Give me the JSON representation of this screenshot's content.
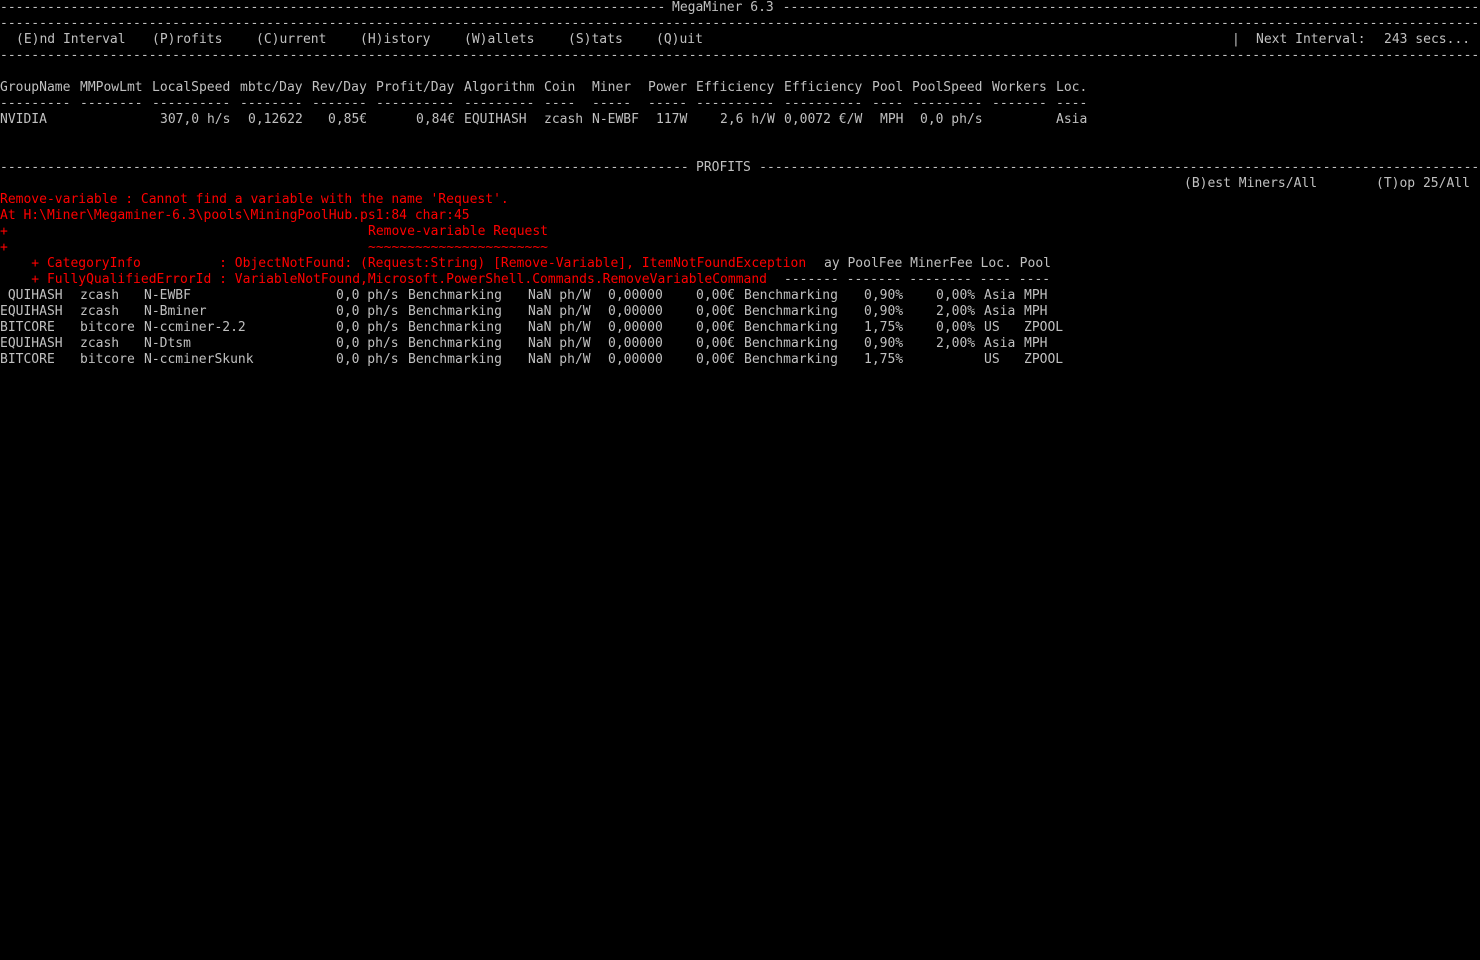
{
  "window": {
    "title": "MegaMiner 6.3"
  },
  "menu": {
    "items": [
      "(E)nd Interval",
      "(P)rofits",
      "(C)urrent",
      "(H)istory",
      "(W)allets",
      "(S)tats",
      "(Q)uit"
    ],
    "separator": "|",
    "next_interval_label": "Next Interval:",
    "next_interval_value": "243 secs..."
  },
  "current": {
    "headers": [
      "GroupName",
      "MMPowLmt",
      "LocalSpeed",
      "mbtc/Day",
      "Rev/Day",
      "Profit/Day",
      "Algorithm",
      "Coin",
      "Miner",
      "Power",
      "Efficiency",
      "Efficiency",
      "Pool",
      "PoolSpeed",
      "Workers",
      "Loc."
    ],
    "underlines": [
      "---------",
      "--------",
      "----------",
      "--------",
      "-------",
      "----------",
      "---------",
      "----",
      "-----",
      "-----",
      "----------",
      "----------",
      "----",
      "---------",
      "-------",
      "----"
    ],
    "rows": [
      [
        "NVIDIA",
        "",
        "307,0 h/s",
        "0,12622",
        "0,85€",
        "0,84€",
        "EQUIHASH",
        "zcash",
        "N-EWBF",
        "117W",
        "2,6 h/W",
        "0,0072 €/W",
        "MPH",
        "0,0 ph/s",
        "",
        "Asia"
      ]
    ]
  },
  "profits": {
    "section_title": "PROFITS",
    "best_miners": "(B)est Miners/All",
    "top25": "(T)op 25/All"
  },
  "error": {
    "line1": "Remove-variable : Cannot find a variable with the name 'Request'.",
    "line2": "At H:\\Miner\\Megaminer-6.3\\pools\\MiningPoolHub.ps1:84 char:45",
    "line3_prefix": "+",
    "line3_cmd": "Remove-variable Request",
    "line4_prefix": "+",
    "line4_tilde": "~~~~~~~~~~~~~~~~~~~~~~~",
    "category_info": "    + CategoryInfo          : ObjectNotFound: (Request:String) [Remove-Variable], ItemNotFoundException",
    "fqid": "    + FullyQualifiedErrorId : VariableNotFound,Microsoft.PowerShell.Commands.RemoveVariableCommand"
  },
  "profits_table": {
    "header_tail": "ay PoolFee MinerFee Loc. Pool",
    "underline_tail": "------- ------- -------- ---- ----",
    "rows": [
      [
        " QUIHASH",
        "zcash",
        "N-EWBF",
        "0,0 ph/s",
        "Benchmarking",
        "NaN ph/W",
        "0,00000",
        "0,00€",
        "Benchmarking",
        "0,90%",
        "0,00%",
        "Asia",
        "MPH"
      ],
      [
        "EQUIHASH",
        "zcash",
        "N-Bminer",
        "0,0 ph/s",
        "Benchmarking",
        "NaN ph/W",
        "0,00000",
        "0,00€",
        "Benchmarking",
        "0,90%",
        "2,00%",
        "Asia",
        "MPH"
      ],
      [
        "BITCORE",
        "bitcore",
        "N-ccminer-2.2",
        "0,0 ph/s",
        "Benchmarking",
        "NaN ph/W",
        "0,00000",
        "0,00€",
        "Benchmarking",
        "1,75%",
        "0,00%",
        "US",
        "ZPOOL"
      ],
      [
        "EQUIHASH",
        "zcash",
        "N-Dtsm",
        "0,0 ph/s",
        "Benchmarking",
        "NaN ph/W",
        "0,00000",
        "0,00€",
        "Benchmarking",
        "0,90%",
        "2,00%",
        "Asia",
        "MPH"
      ],
      [
        "BITCORE",
        "bitcore",
        "N-ccminerSkunk",
        "0,0 ph/s",
        "Benchmarking",
        "NaN ph/W",
        "0,00000",
        "0,00€",
        "Benchmarking",
        "1,75%",
        "",
        "US",
        "ZPOOL"
      ]
    ]
  }
}
